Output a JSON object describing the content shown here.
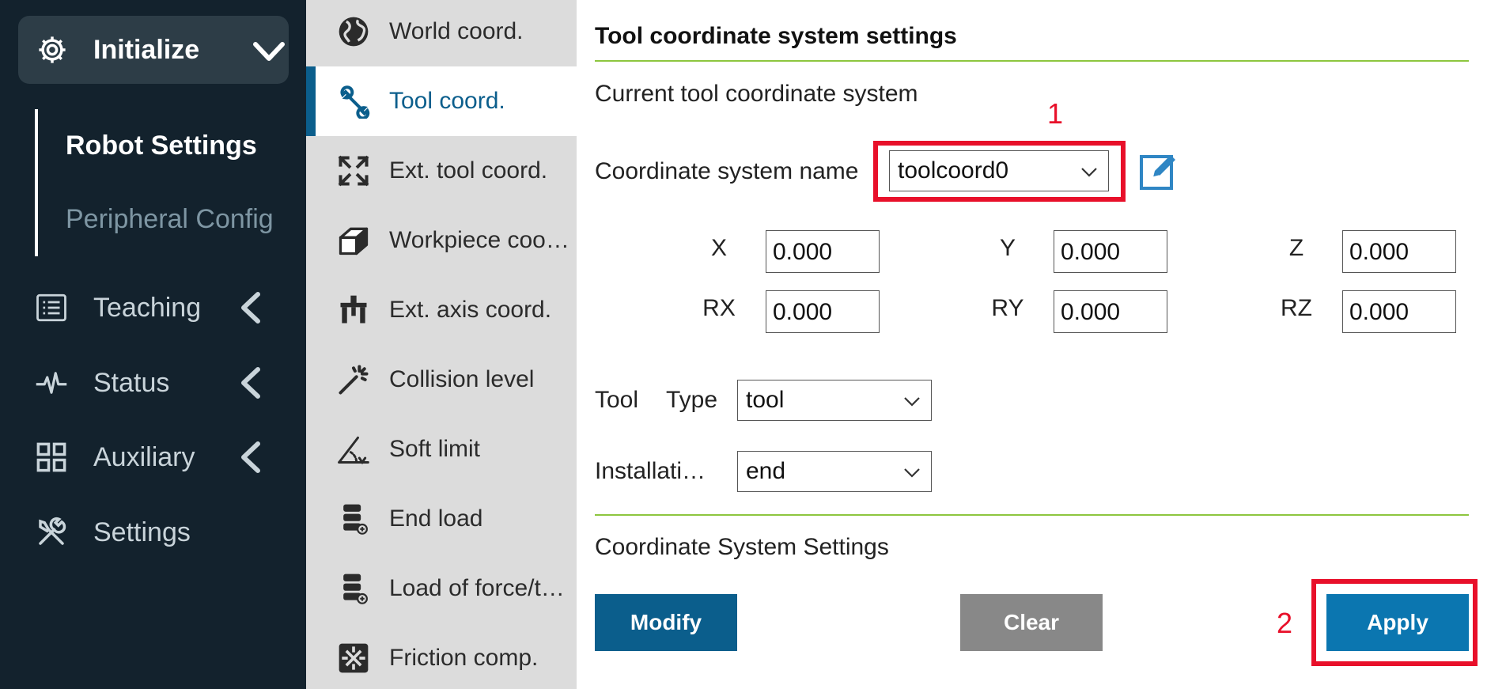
{
  "sidebar": {
    "header": {
      "label": "Initialize",
      "icon": "gear-icon"
    },
    "sub_items": [
      {
        "label": "Robot Settings",
        "active": true
      },
      {
        "label": "Peripheral Config",
        "active": false
      }
    ],
    "nav": [
      {
        "label": "Teaching",
        "icon": "list-icon"
      },
      {
        "label": "Status",
        "icon": "pulse-icon"
      },
      {
        "label": "Auxiliary",
        "icon": "grid-icon"
      },
      {
        "label": "Settings",
        "icon": "tools-icon"
      }
    ]
  },
  "submenu": {
    "items": [
      {
        "label": "World coord.",
        "icon": "globe-icon"
      },
      {
        "label": "Tool coord.",
        "icon": "wrench-icon",
        "active": true
      },
      {
        "label": "Ext. tool coord.",
        "icon": "expand-icon"
      },
      {
        "label": "Workpiece coord.",
        "icon": "cube-icon"
      },
      {
        "label": "Ext. axis coord.",
        "icon": "axis-icon"
      },
      {
        "label": "Collision level",
        "icon": "magic-wand-icon"
      },
      {
        "label": "Soft limit",
        "icon": "angle-icon"
      },
      {
        "label": "End load",
        "icon": "database-icon"
      },
      {
        "label": "Load of force/torque sensor",
        "icon": "database-plus-icon"
      },
      {
        "label": "Friction comp.",
        "icon": "friction-icon"
      }
    ]
  },
  "main": {
    "title": "Tool coordinate system settings",
    "current_label": "Current tool coordinate system",
    "name_label": "Coordinate system name",
    "name_value": "toolcoord0",
    "coords": [
      {
        "label": "X",
        "value": "0.000"
      },
      {
        "label": "Y",
        "value": "0.000"
      },
      {
        "label": "Z",
        "value": "0.000"
      },
      {
        "label": "RX",
        "value": "0.000"
      },
      {
        "label": "RY",
        "value": "0.000"
      },
      {
        "label": "RZ",
        "value": "0.000"
      }
    ],
    "tool_label": "Tool",
    "type_label": "Type",
    "type_value": "tool",
    "install_label": "Installati…",
    "install_value": "end",
    "cs_settings_label": "Coordinate System Settings",
    "buttons": {
      "modify": "Modify",
      "clear": "Clear",
      "apply": "Apply"
    }
  },
  "annotations": {
    "one": "1",
    "two": "2"
  },
  "colors": {
    "sidebar_bg": "#13222d",
    "submenu_bg": "#dcdcdc",
    "accent_blue": "#0b5e8c",
    "divider_green": "#8dc63f",
    "annotation_red": "#e8102a"
  }
}
